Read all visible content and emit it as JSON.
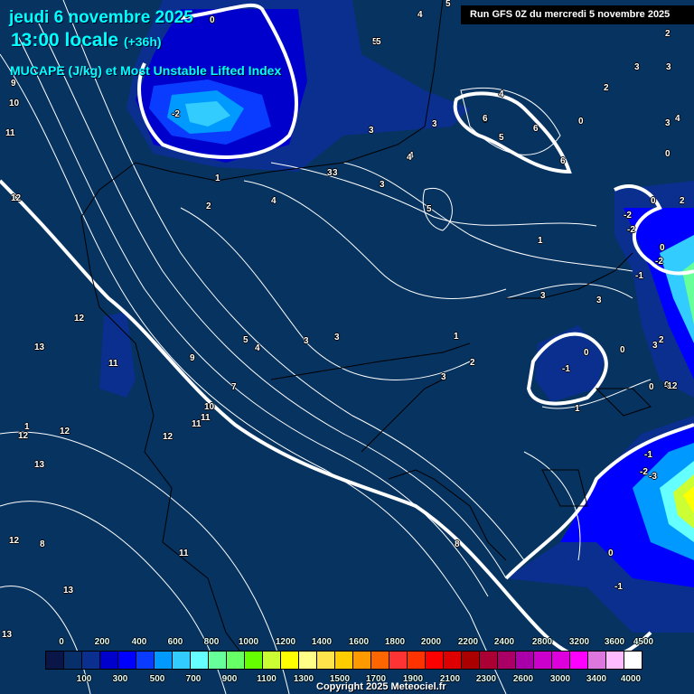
{
  "header": {
    "date": "jeudi 6 novembre 2025",
    "time": "13:00 locale",
    "lead": "(+36h)",
    "parameter": "MUCAPE (J/kg) et Most Unstable Lifted Index",
    "run": "Run GFS 0Z du mercredi 5 novembre 2025"
  },
  "legend": {
    "colors": [
      "#0a1648",
      "#07306a",
      "#0a2f8f",
      "#0000cc",
      "#0000ff",
      "#0a3cff",
      "#0099ff",
      "#33ccff",
      "#66ffff",
      "#66ff99",
      "#66ff66",
      "#66ff00",
      "#ccff33",
      "#ffff00",
      "#ffff88",
      "#ffe44c",
      "#ffcc00",
      "#ff9900",
      "#ff6600",
      "#ff3333",
      "#ff3300",
      "#ff0000",
      "#dd0000",
      "#aa0000",
      "#aa0033",
      "#aa0066",
      "#aa00aa",
      "#cc00cc",
      "#dd00dd",
      "#ff00ff",
      "#dd77dd",
      "#ffbbff",
      "#ffffff"
    ],
    "top_labels": [
      "0",
      "200",
      "400",
      "600",
      "800",
      "1000",
      "1200",
      "1400",
      "1600",
      "1800",
      "2000",
      "2200",
      "2400",
      "2800",
      "3200",
      "3600",
      "4500"
    ],
    "bottom_labels": [
      "100",
      "300",
      "500",
      "700",
      "900",
      "1100",
      "1300",
      "1500",
      "1700",
      "1900",
      "2100",
      "2300",
      "2600",
      "3000",
      "3400",
      "4000"
    ]
  },
  "contour_labels": [
    "0",
    "-2",
    "9",
    "10",
    "11",
    "12",
    "12",
    "13",
    "11",
    "12",
    "12",
    "13",
    "12",
    "11",
    "11",
    "13",
    "13",
    "1",
    "2",
    "1",
    "3",
    "3",
    "4",
    "5",
    "3",
    "4",
    "3",
    "5",
    "3",
    "3",
    "4",
    "5",
    "6",
    "5",
    "6",
    "6",
    "2",
    "3",
    "4",
    "5",
    "4",
    "3",
    "2",
    "4",
    "0",
    "2",
    "-2",
    "-2",
    "0",
    "-2",
    "-1",
    "0",
    "1",
    "3",
    "3",
    "0",
    "-1",
    "0",
    "0",
    "3",
    "2",
    "0",
    "-12",
    "1",
    "-1",
    "-2",
    "-3",
    "0",
    "-1",
    "2",
    "3",
    "1",
    "3",
    "6",
    "5",
    "4",
    "8",
    "7",
    "9",
    "10",
    "11",
    "12",
    "8",
    "3",
    "4",
    "0"
  ],
  "copyright": "Copyright 2025 Meteociel.fr"
}
